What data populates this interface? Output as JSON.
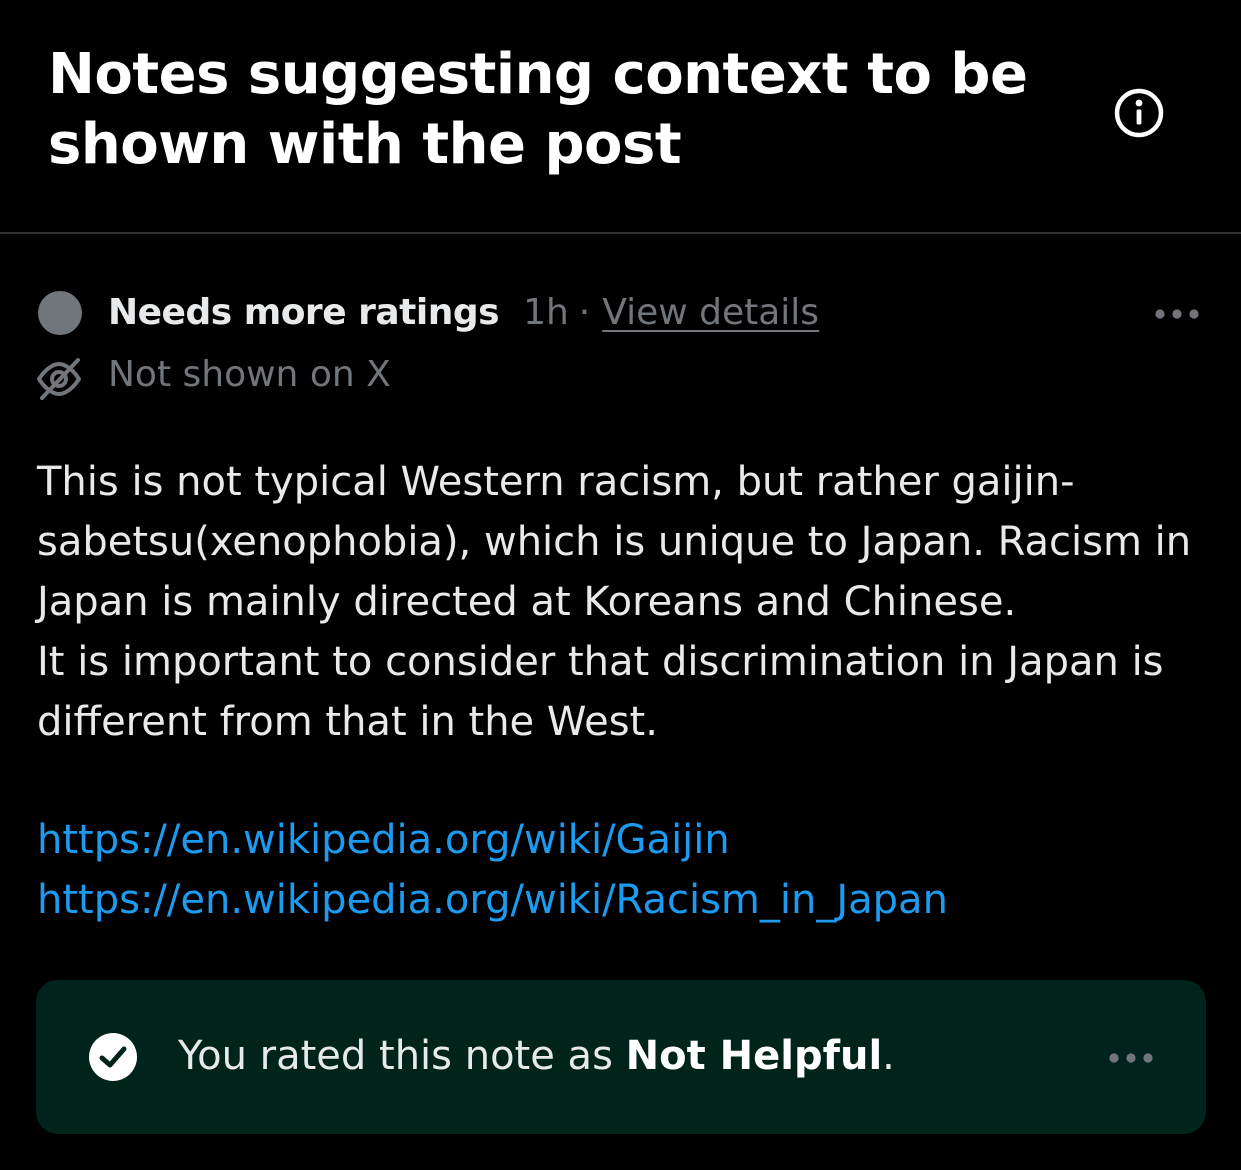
{
  "header": {
    "title": "Notes suggesting context to be shown with the post",
    "info_icon": "info-circle-icon"
  },
  "note": {
    "status_label": "Needs more ratings",
    "status_color": "#71767b",
    "time": "1h",
    "separator": "·",
    "view_details_label": "View details",
    "visibility_label": "Not shown on X",
    "visibility_icon": "eye-off-icon",
    "more_icon": "more-horizontal-icon",
    "body_paragraphs": [
      "This is not typical Western racism, but rather gaijin-sabetsu(xenophobia), which is unique to Japan. Racism in Japan is mainly directed at Koreans and Chinese.",
      "It is important to consider that discrimination in Japan is different from that in the West."
    ],
    "links": [
      "https://en.wikipedia.org/wiki/Gaijin",
      "https://en.wikipedia.org/wiki/Racism_in_Japan"
    ],
    "link_color": "#1d9bf0"
  },
  "rating": {
    "prefix": "You rated this note as ",
    "value": "Not Helpful",
    "suffix": ".",
    "check_icon": "check-circle-icon",
    "more_icon": "more-horizontal-icon",
    "card_color": "#00241b"
  }
}
